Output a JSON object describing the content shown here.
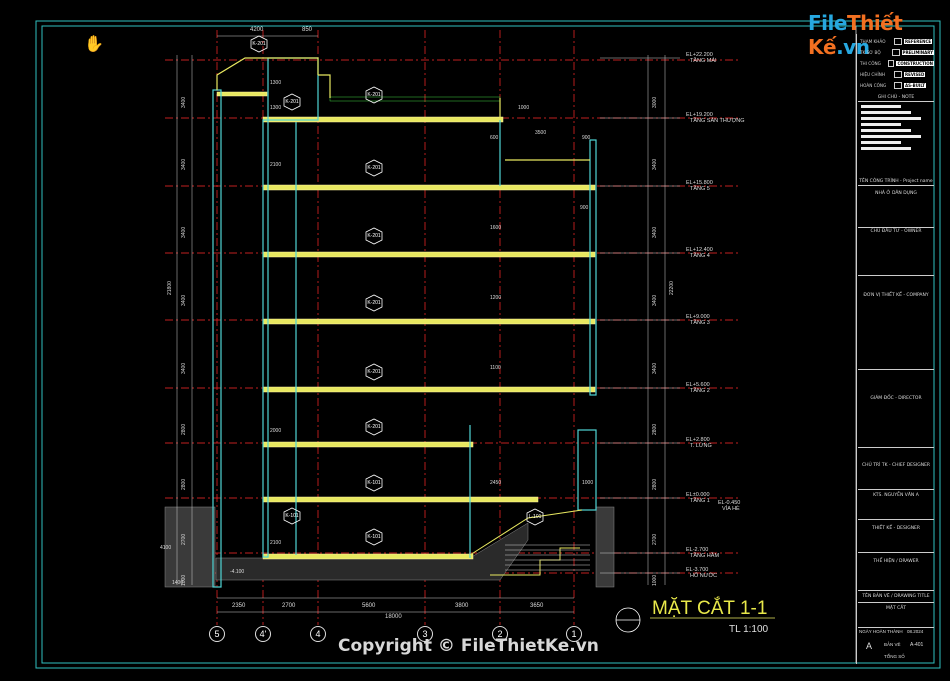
{
  "watermark": {
    "logo_main": "File",
    "logo_accent": "Thiết Kế",
    "logo_suffix": ".vn",
    "copyright": "Copyright © FileThietKe.vn"
  },
  "title": {
    "main": "MẶT CẮT 1-1",
    "scale": "TL 1:100"
  },
  "titleblock": {
    "status_rows": [
      {
        "label": "THAM KHẢO",
        "value": "REFERENCE"
      },
      {
        "label": "TK SƠ BỘ",
        "value": "PRELIMINARY"
      },
      {
        "label": "THI CÔNG",
        "value": "CONSTRUCTION"
      },
      {
        "label": "HIỆU CHỈNH",
        "value": "REVISED"
      },
      {
        "label": "HOÀN CÔNG",
        "value": "AS-BUILT"
      }
    ],
    "note_header": "GHI CHÚ - NOTE",
    "project_label": "TÊN CÔNG TRÌNH - Project name",
    "project_name": "NHÀ Ở DÂN DỤNG",
    "owner": "CHỦ ĐẦU TƯ - OWNER",
    "company": "ĐƠN VỊ THIẾT KẾ - COMPANY",
    "director": "GIÁM ĐỐC - DIRECTOR",
    "chief": "CHỦ TRÌ TK - CHIEF DESIGNER",
    "designer_name": "KTS. NGUYỄN VĂN A",
    "designer": "THIẾT KẾ - DESIGNER",
    "drawer": "THỂ HIỆN / DRAWER",
    "drawing_title_label": "TÊN BẢN VẼ / DRAWING TITLE",
    "drawing_title": "MẶT CẮT",
    "date_label": "NGÀY HOÀN THÀNH",
    "date": "08.2024",
    "sheet_label": "BẢN VẼ",
    "sheet_no": "A-401",
    "rev": "A",
    "total_label": "TỔNG SỐ"
  },
  "levels": [
    {
      "el": "EL+22.200",
      "name": "TẦNG MÁI"
    },
    {
      "el": "EL+19.200",
      "name": "TẦNG SÂN THƯỢNG"
    },
    {
      "el": "EL+15.800",
      "name": "TẦNG 5"
    },
    {
      "el": "EL+12.400",
      "name": "TẦNG 4"
    },
    {
      "el": "EL+9.000",
      "name": "TẦNG 3"
    },
    {
      "el": "EL+5.600",
      "name": "TẦNG 2"
    },
    {
      "el": "EL+2.800",
      "name": "T. LỬNG"
    },
    {
      "el": "EL±0.000",
      "name": "TẦNG 1"
    },
    {
      "el": "EL-0.450",
      "name": "VỈA HÈ"
    },
    {
      "el": "EL-2.700",
      "name": "TẦNG HẦM"
    },
    {
      "el": "EL-3.700",
      "name": "HỐ NƯỚC"
    }
  ],
  "axes": [
    "5",
    "4'",
    "4",
    "3",
    "2",
    "1"
  ],
  "dims_bottom": [
    "2350",
    "2700",
    "5600",
    "3800",
    "3650"
  ],
  "dim_total": "18000",
  "dims_top": [
    "4200",
    "850"
  ],
  "dims_right": [
    "3000",
    "3400",
    "3400",
    "3400",
    "3400",
    "2800",
    "2800",
    "2700",
    "1000"
  ],
  "dims_right_total": "22200",
  "dims_left": [
    "3400",
    "3400",
    "3400",
    "3400",
    "3400",
    "2800",
    "2800",
    "2700",
    "1000"
  ],
  "dims_left_total": "21800",
  "inner_dims": [
    "2100",
    "1300",
    "900",
    "3500",
    "900",
    "1000",
    "600",
    "1600",
    "1200",
    "1100",
    "2450",
    "2000",
    "2100",
    "1300",
    "1400",
    "4100",
    "1000"
  ],
  "room_tags": [
    "K-201",
    "K-201",
    "K-201",
    "K-201",
    "K-201",
    "K-201",
    "K-201",
    "K-201",
    "K-101",
    "K-101",
    "L-101",
    "K-101"
  ],
  "spot_level": "-4.100",
  "colors": {
    "bg": "#000000",
    "slab": "#e8e860",
    "wall": "#4fd4d4",
    "grid": "#ff2a2a",
    "dim": "#cfcfcf",
    "frame": "#2fbfbf",
    "ground": "#9a9a9a"
  }
}
